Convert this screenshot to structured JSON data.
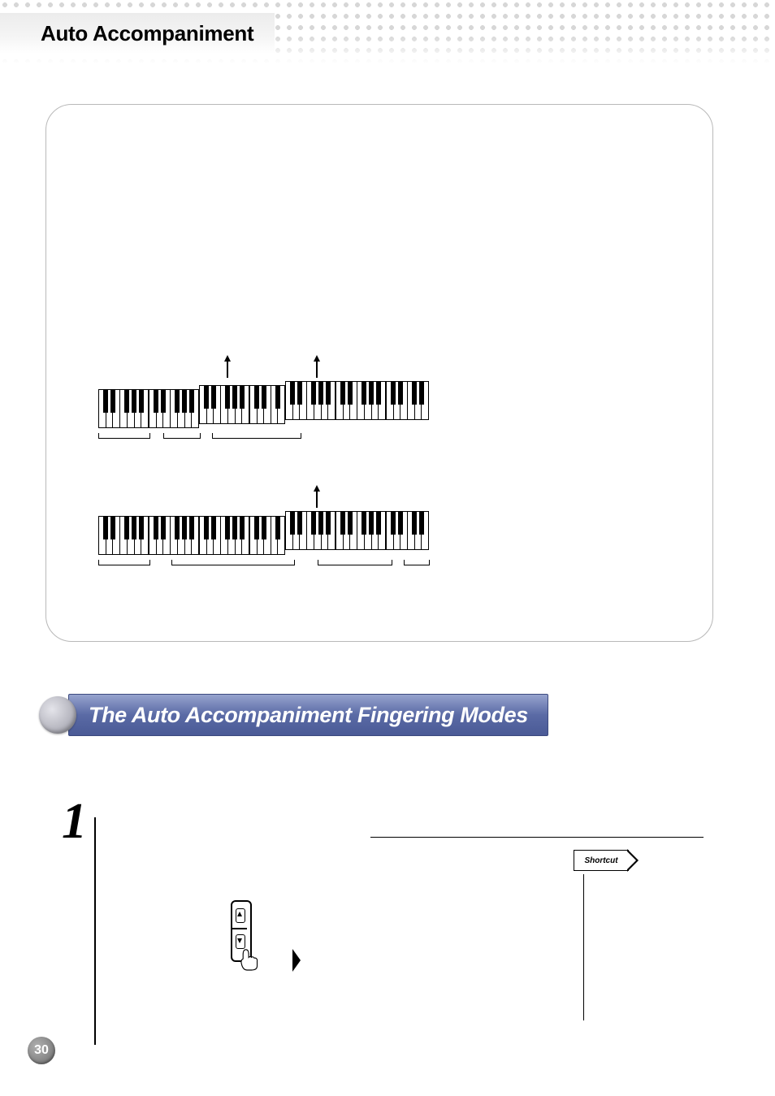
{
  "section_title": "Auto Accompaniment",
  "heading": "The Auto Accompaniment Fingering Modes",
  "step": {
    "number": "1"
  },
  "shortcut_label": "Shortcut",
  "page_number": "30"
}
